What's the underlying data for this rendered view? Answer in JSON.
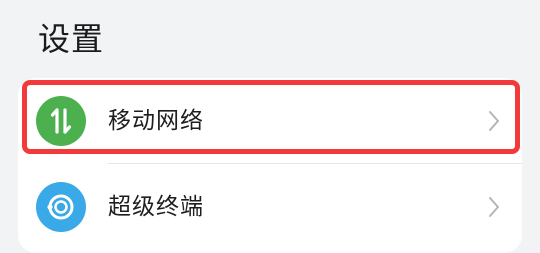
{
  "header": {
    "title": "设置"
  },
  "settings": {
    "items": [
      {
        "label": "移动网络",
        "icon": "mobile-data-icon",
        "icon_color": "#4cb04f"
      },
      {
        "label": "超级终端",
        "icon": "super-device-icon",
        "icon_color": "#39a9e8"
      }
    ]
  },
  "highlight": {
    "target": "移动网络",
    "color": "#f23a3a"
  },
  "colors": {
    "background": "#f1f3f5",
    "card": "#ffffff"
  }
}
